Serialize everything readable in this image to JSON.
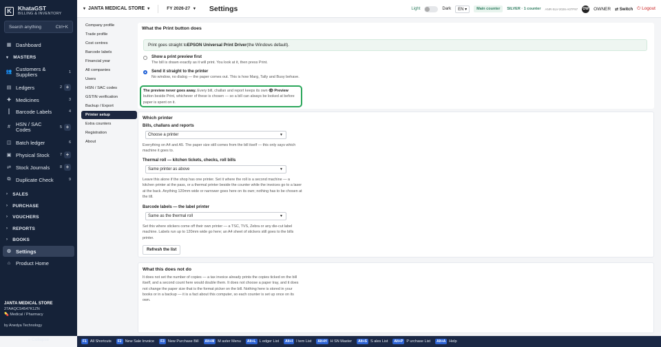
{
  "app": {
    "name": "KhataGST",
    "tagline": "BILLING & INVENTORY",
    "logo_letter": "K"
  },
  "search": {
    "placeholder": "Search anything",
    "shortcut": "Ctrl+K"
  },
  "sidebar": {
    "items": [
      {
        "label": "Dashboard",
        "icon": "dashboard-icon"
      },
      {
        "label": "MASTERS",
        "type": "section"
      },
      {
        "label": "Customers & Suppliers",
        "count": "1",
        "icon": "users-icon"
      },
      {
        "label": "Ledgers",
        "count": "2",
        "plus": "+",
        "icon": "ledger-icon"
      },
      {
        "label": "Medicines",
        "count": "3",
        "icon": "pill-icon"
      },
      {
        "label": "Barcode Labels",
        "count": "4",
        "icon": "barcode-icon"
      },
      {
        "label": "HSN / SAC Codes",
        "count": "5",
        "plus": "+",
        "icon": "hash-icon"
      },
      {
        "label": "Batch ledger",
        "count": "6",
        "icon": "batch-icon"
      },
      {
        "label": "Physical Stock",
        "count": "7",
        "plus": "+",
        "icon": "box-icon"
      },
      {
        "label": "Stock Journals",
        "count": "8",
        "plus": "+",
        "icon": "journal-icon"
      },
      {
        "label": "Duplicate Check",
        "count": "9",
        "icon": "duplicate-icon"
      },
      {
        "label": "SALES",
        "type": "section"
      },
      {
        "label": "PURCHASE",
        "type": "section"
      },
      {
        "label": "VOUCHERS",
        "type": "section"
      },
      {
        "label": "REPORTS",
        "type": "section"
      },
      {
        "label": "BOOKS",
        "type": "section"
      },
      {
        "label": "Settings",
        "icon": "gear-icon",
        "active": true
      },
      {
        "label": "Product Home",
        "icon": "home-icon"
      }
    ],
    "footer": {
      "company": "JANTA MEDICAL STORE",
      "gstin": "27AAQCS4547K1ZN",
      "business_type": "Medical / Pharmacy",
      "by": "by Anedya Technology"
    },
    "collapse_label": "« Collapse"
  },
  "topbar": {
    "company": "JANTA MEDICAL STORE",
    "fy": "FY 2026-27",
    "title": "Settings",
    "theme_light": "Light",
    "theme_dark": "Dark",
    "language": "EN",
    "counter": "Main counter",
    "license": "SILVER · 1 counter",
    "license_code": "ANR-SLV-2026-A07F97",
    "user_initials": "OW",
    "user_role": "OWNER",
    "switch_label": "Switch",
    "logout_label": "Logout"
  },
  "settings_nav": [
    "Company profile",
    "Trade profile",
    "Cost centres",
    "Barcode labels",
    "Financial year",
    "All companies",
    "Users",
    "HSN / SAC codes",
    "GSTIN verification",
    "Backup / Export",
    "Printer setup",
    "Extra counters",
    "Registration",
    "About"
  ],
  "settings_nav_active": "Printer setup",
  "print_button": {
    "heading": "What the Print button does",
    "hint_pre": "Print goes straight to ",
    "hint_bold": "EPSON Universal Print Driver",
    "hint_post": " (the Windows default).",
    "options": [
      {
        "title": "Show a print preview first",
        "sub": "The bill is drawn exactly as it will print. You look at it, then press Print.",
        "selected": false
      },
      {
        "title": "Send it straight to the printer",
        "sub": "No window, no dialog — the paper comes out. This is how Marg, Tally and Busy behave.",
        "selected": true
      }
    ],
    "note_bold": "The preview never goes away.",
    "note_rest1": " Every bill, challan and report keeps its own ",
    "note_preview": "👁 Preview",
    "note_rest2": " button beside Print, whichever of these is chosen — so a bill can always be looked at before paper is spent on it."
  },
  "which_printer": {
    "heading": "Which printer",
    "fields": [
      {
        "label": "Bills, challans and reports",
        "value": "Choose a printer",
        "help": "Everything on A4 and A5. The paper size still comes from the bill itself — this only says which machine it goes to."
      },
      {
        "label": "Thermal roll — kitchen tickets, checks, roll bills",
        "value": "Same printer as above",
        "help": "Leave this alone if the shop has one printer. Set it where the roll is a second machine — a kitchen printer at the pass, or a thermal printer beside the counter while the invoices go to a laser at the back. Anything 120mm wide or narrower goes here on its own; nothing has to be chosen at the till."
      },
      {
        "label": "Barcode labels — the label printer",
        "value": "Same as the thermal roll",
        "help": "Set this where stickers come off their own printer — a TSC, TVS, Zebra or any die-cut label machine. Labels run up to 120mm wide go here; an A4 sheet of stickers still goes to the bills printer."
      }
    ],
    "refresh_label": "Refresh the list"
  },
  "not_do": {
    "heading": "What this does not do",
    "text": "It does not set the number of copies — a tax invoice already prints the copies ticked on the bill itself, and a second count here would double them. It does not choose a paper tray, and it does not change the paper size that is the format picker on the bill. Nothing here is stored in your books or in a backup — it is a fact about this computer, so each counter is set up once on its own."
  },
  "shortcuts": [
    {
      "key": "F1",
      "label": "All Shortcuts"
    },
    {
      "key": "F2",
      "label": "New Sale Invoice"
    },
    {
      "key": "F3",
      "label": "New Purchase Bill"
    },
    {
      "key": "Alt+M",
      "label": "M aster Menu"
    },
    {
      "key": "Alt+L",
      "label": "L edger List"
    },
    {
      "key": "Alt+I",
      "label": "I tem List"
    },
    {
      "key": "Alt+H",
      "label": "H SN Master"
    },
    {
      "key": "Alt+S",
      "label": "S ales List"
    },
    {
      "key": "Alt+P",
      "label": "P urchase List"
    },
    {
      "key": "Alt+A",
      "label": "Help"
    }
  ]
}
